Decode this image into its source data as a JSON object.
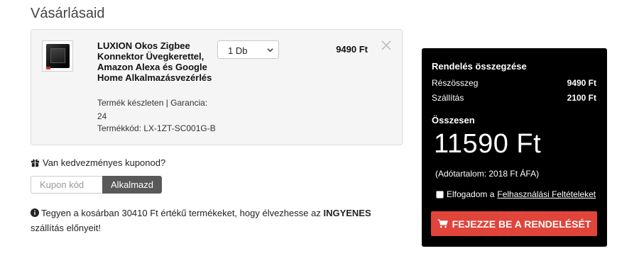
{
  "page": {
    "title": "Vásárlásaid"
  },
  "cart_item": {
    "name": "LUXION Okos Zigbee Konnektor Üvegkerettel, Amazon Alexa és Google Home Alkalmazásvezérlés",
    "stock": "Termék készleten | Garancia: 24",
    "code": "Termékkód: LX-1ZT-SC001G-B",
    "quantity": "1 Db",
    "price": "9490 Ft",
    "thumbnail_icon": "product-thumbnail",
    "remove_icon": "close-icon"
  },
  "coupon": {
    "question": "Van kedvezményes kuponod?",
    "icon": "gift-icon",
    "placeholder": "Kupon kód",
    "apply_label": "Alkalmazd"
  },
  "shipping_notice": {
    "icon": "info-circle-icon",
    "text_before": "Tegyen a kosárban 30410 Ft értékű termékeket, hogy élvezhesse az ",
    "highlight": "INGYENES",
    "text_after": " szállítás előnyeit!"
  },
  "summary": {
    "title": "Rendelés összegzése",
    "subtotal_label": "Részösszeg",
    "subtotal_value": "9490 Ft",
    "shipping_label": "Szállítás",
    "shipping_value": "2100 Ft",
    "total_label": "Összesen",
    "total_value": "11590 Ft",
    "tax": "(Adótartalom: 2018 Ft ÁFA)",
    "terms_prefix": "Elfogadom a",
    "terms_link": "Felhasználási Feltételeket",
    "checkout_label": "FEJEZZE BE A RENDELÉSÉT",
    "checkout_icon": "cart-icon"
  },
  "colors": {
    "summary_bg": "#000000",
    "checkout_button": "#e0443a",
    "coupon_button": "#595959",
    "item_bg": "#f5f5f5"
  }
}
